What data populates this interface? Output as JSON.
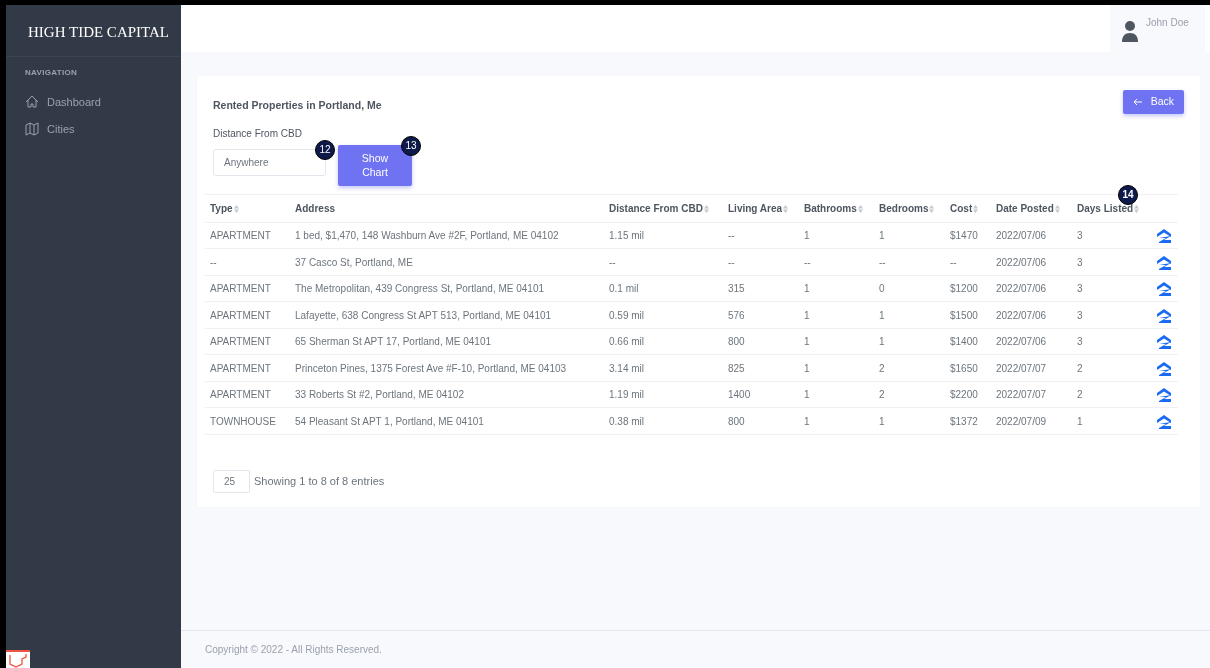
{
  "brand": "HIGH TIDE CAPITAL",
  "sidebar": {
    "heading": "NAVIGATION",
    "items": [
      {
        "label": "Dashboard",
        "kind": "home",
        "selected": false
      },
      {
        "label": "Cities",
        "kind": "map",
        "selected": false
      }
    ]
  },
  "user": {
    "name": "John Doe"
  },
  "card": {
    "title": "Rented Properties in Portland, Me",
    "back_button": "Back",
    "filter": {
      "label": "Distance From CBD",
      "value": "Anywhere",
      "badge": "12"
    },
    "show_chart": {
      "label": "Show Chart",
      "badge": "13"
    },
    "table_badge": "14",
    "columns": [
      "Type",
      "Address",
      "Distance From CBD",
      "Living Area",
      "Bathrooms",
      "Bedrooms",
      "Cost",
      "Date Posted",
      "Days Listed"
    ],
    "rows": [
      [
        "APARTMENT",
        "1 bed, $1,470, 148 Washburn Ave #2F, Portland, ME 04102",
        "1.15 mil",
        "--",
        "1",
        "1",
        "$1470",
        "2022/07/06",
        "3"
      ],
      [
        "--",
        "37 Casco St, Portland, ME",
        "--",
        "--",
        "--",
        "--",
        "--",
        "2022/07/06",
        "3"
      ],
      [
        "APARTMENT",
        "The Metropolitan, 439 Congress St, Portland, ME 04101",
        "0.1 mil",
        "315",
        "1",
        "0",
        "$1200",
        "2022/07/06",
        "3"
      ],
      [
        "APARTMENT",
        "Lafayette, 638 Congress St APT 513, Portland, ME 04101",
        "0.59 mil",
        "576",
        "1",
        "1",
        "$1500",
        "2022/07/06",
        "3"
      ],
      [
        "APARTMENT",
        "65 Sherman St APT 17, Portland, ME 04101",
        "0.66 mil",
        "800",
        "1",
        "1",
        "$1400",
        "2022/07/06",
        "3"
      ],
      [
        "APARTMENT",
        "Princeton Pines, 1375 Forest Ave #F-10, Portland, ME 04103",
        "3.14 mil",
        "825",
        "1",
        "2",
        "$1650",
        "2022/07/07",
        "2"
      ],
      [
        "APARTMENT",
        "33 Roberts St #2, Portland, ME 04102",
        "1.19 mil",
        "1400",
        "1",
        "2",
        "$2200",
        "2022/07/07",
        "2"
      ],
      [
        "TOWNHOUSE",
        "54 Pleasant St APT 1, Portland, ME 04101",
        "0.38 mil",
        "800",
        "1",
        "1",
        "$1372",
        "2022/07/09",
        "1"
      ]
    ],
    "page_size": "25",
    "info": "Showing 1 to 8 of 8 entries"
  },
  "footer": "Copyright © 2022 - All Rights Reserved."
}
